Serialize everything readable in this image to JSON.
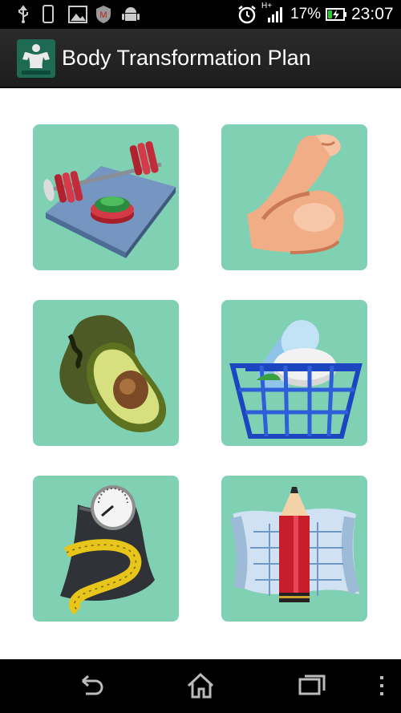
{
  "status_bar": {
    "battery_percent": "17%",
    "time": "23:07",
    "network_type": "H+",
    "icons": [
      "usb-icon",
      "phone-icon",
      "image-icon",
      "mcafee-icon",
      "android-icon",
      "alarm-icon",
      "signal-icon",
      "battery-icon"
    ]
  },
  "action_bar": {
    "title": "Body Transformation Plan",
    "logo_icon": "bodybuilder-logo-icon"
  },
  "tiles": [
    {
      "name": "workouts-tile",
      "icon": "barbell-icon"
    },
    {
      "name": "muscles-tile",
      "icon": "flexed-arm-icon"
    },
    {
      "name": "nutrition-tile",
      "icon": "avocado-icon"
    },
    {
      "name": "supplements-tile",
      "icon": "pill-basket-icon"
    },
    {
      "name": "body-stats-tile",
      "icon": "scale-tape-icon"
    },
    {
      "name": "planner-tile",
      "icon": "pencil-blueprint-icon"
    }
  ],
  "colors": {
    "tile_background": "#80d1b3",
    "action_bar": "#222222",
    "status_bar": "#000000"
  },
  "nav_bar": {
    "buttons": [
      "back-icon",
      "home-icon",
      "recent-apps-icon",
      "menu-icon"
    ]
  }
}
